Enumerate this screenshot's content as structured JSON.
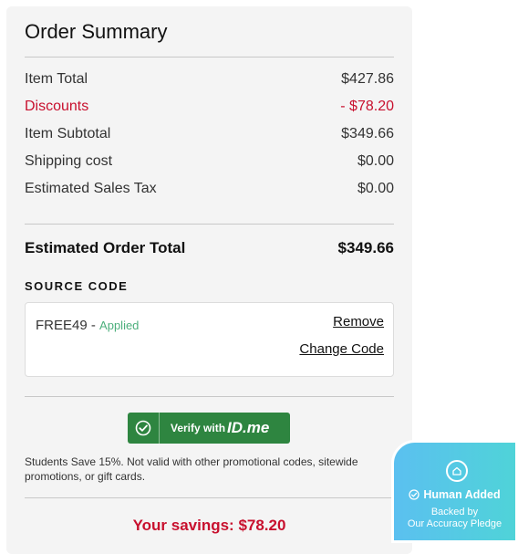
{
  "summary": {
    "title": "Order Summary",
    "rows": [
      {
        "label": "Item Total",
        "value": "$427.86"
      },
      {
        "label": "Discounts",
        "value": "- $78.20"
      },
      {
        "label": "Item Subtotal",
        "value": "$349.66"
      },
      {
        "label": "Shipping cost",
        "value": "$0.00"
      },
      {
        "label": "Estimated Sales Tax",
        "value": "$0.00"
      }
    ],
    "total_label": "Estimated Order Total",
    "total_value": "$349.66"
  },
  "source_code": {
    "heading": "SOURCE CODE",
    "code": "FREE49",
    "separator": " - ",
    "status": "Applied",
    "remove_label": "Remove",
    "change_label": "Change Code"
  },
  "idme": {
    "prefix": "Verify with",
    "brand": "ID.me",
    "note": "Students Save 15%. Not valid with other promotional codes, sitewide promotions, or gift cards."
  },
  "savings_text": "Your savings: $78.20",
  "badge": {
    "title": "Human Added",
    "line1": "Backed by",
    "line2": "Our Accuracy Pledge"
  },
  "colors": {
    "accent_red": "#c8102e",
    "idme_green": "#2e8540",
    "applied_green": "#4caf7c",
    "badge_cyan": "#4fd3d8"
  }
}
